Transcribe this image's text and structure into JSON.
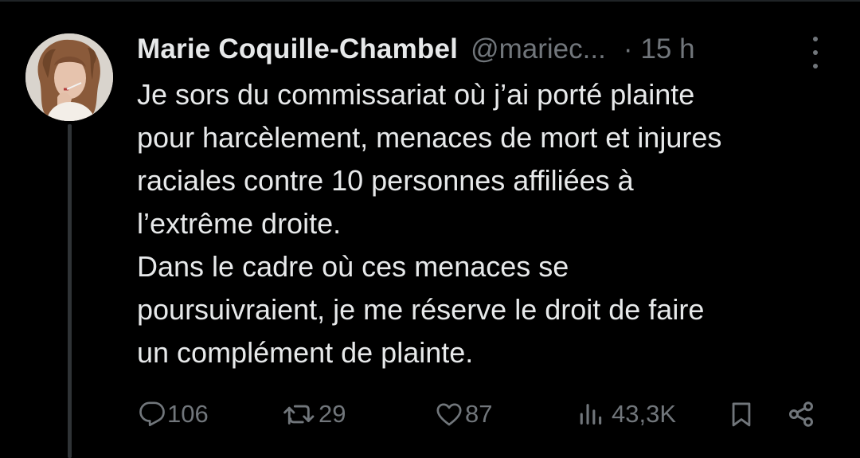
{
  "tweet": {
    "author": {
      "display_name": "Marie Coquille-Chambel",
      "handle": "@mariec...",
      "avatar_icon": "profile-photo"
    },
    "separator": "·",
    "time": "15 h",
    "text": "Je sors du commissariat où j’ai porté plainte\npour harcèlement, menaces de mort et injures\nraciales contre 10 personnes affiliées à\nl’extrême droite.\nDans le cadre où ces menaces se\npoursuivraient, je me réserve le droit de faire\nun complément de plainte.",
    "stats": {
      "replies": "106",
      "reposts": "29",
      "likes": "87",
      "views": "43,3K"
    },
    "icons": {
      "more": "more-dots-icon",
      "reply": "reply-icon",
      "repost": "repost-icon",
      "like": "heart-icon",
      "views": "views-icon",
      "bookmark": "bookmark-icon",
      "share": "share-icon"
    }
  },
  "colors": {
    "background": "#000000",
    "primary_text": "#e7e9ea",
    "secondary_text": "#71767b",
    "thread_line": "#2f3336"
  }
}
